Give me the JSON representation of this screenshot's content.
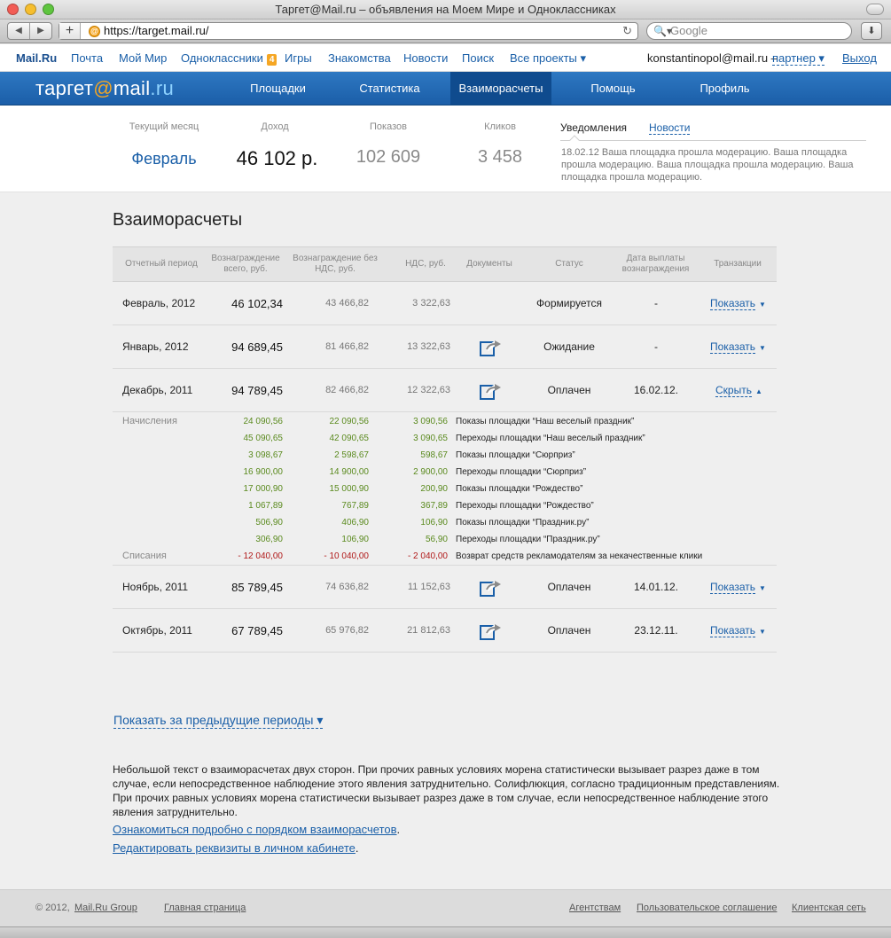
{
  "window": {
    "title": "Таргет@Mail.ru – объявления на Моем Мире и Одноклассниках"
  },
  "browser": {
    "url": "https://target.mail.ru/",
    "search_placeholder": "Google",
    "back_glyph": "◀",
    "forward_glyph": "▶",
    "new_tab_glyph": "+",
    "reload_glyph": "↻",
    "download_glyph": "⬇",
    "search_icon_glyph": "🔍▾"
  },
  "portal": {
    "brand": "Mail.Ru",
    "links": [
      {
        "label": "Почта"
      },
      {
        "label": "Мой Мир"
      },
      {
        "label": "Одноклассники",
        "badge": "4"
      },
      {
        "label": "Игры"
      },
      {
        "label": "Знакомства"
      },
      {
        "label": "Новости"
      },
      {
        "label": "Поиск"
      },
      {
        "label": "Все проекты ▾"
      }
    ],
    "user": "konstantinopol@mail.ru –",
    "partner": "партнер ▾",
    "logout": "Выход"
  },
  "nav": {
    "logo_left": "таргет",
    "logo_at": "@",
    "logo_mail": "mail",
    "logo_ru": ".ru",
    "items": [
      "Площадки",
      "Статистика",
      "Взаиморасчеты",
      "Помощь",
      "Профиль"
    ],
    "active_index": 2
  },
  "summary": {
    "labels": [
      "Текущий месяц",
      "Доход",
      "Показов",
      "Кликов"
    ],
    "month": "Февраль",
    "income": "46 102 р.",
    "shows": "102 609",
    "clicks": "3 458",
    "tab_active": "Уведомления",
    "tab_news": "Новости",
    "notice": "18.02.12 Ваша площадка прошла модерацию. Ваша площадка прошла модерацию. Ваша площадка прошла модерацию. Ваша площадка прошла модерацию."
  },
  "page": {
    "title": "Взаиморасчеты"
  },
  "table": {
    "headers": [
      "Отчетный период",
      "Вознаграждение всего, руб.",
      "Вознаграждение без НДС, руб.",
      "НДС, руб.",
      "Документы",
      "Статус",
      "Дата выплаты вознаграждения",
      "Транзакции"
    ],
    "rows": [
      {
        "period": "Февраль, 2012",
        "total": "46 102,34",
        "nonds": "43 466,82",
        "nds": "3 322,63",
        "doc": false,
        "status": "Формируется",
        "date": "-",
        "trans": "Показать",
        "caret": "▼"
      },
      {
        "period": "Январь, 2012",
        "total": "94 689,45",
        "nonds": "81 466,82",
        "nds": "13 322,63",
        "doc": true,
        "status": "Ожидание",
        "date": "-",
        "trans": "Показать",
        "caret": "▼"
      },
      {
        "period": "Декабрь, 2011",
        "total": "94 789,45",
        "nonds": "82 466,82",
        "nds": "12 322,63",
        "doc": true,
        "status": "Оплачен",
        "date": "16.02.12.",
        "trans": "Скрыть",
        "caret": "▲"
      }
    ],
    "details": [
      {
        "label": "Начисления",
        "total": "24 090,56",
        "nonds": "22 090,56",
        "nds": "3 090,56",
        "desc": "Показы площадки “Наш веселый праздник”"
      },
      {
        "label": "",
        "total": "45 090,65",
        "nonds": "42 090,65",
        "nds": "3 090,65",
        "desc": "Переходы площадки “Наш веселый праздник”"
      },
      {
        "label": "",
        "total": "3 098,67",
        "nonds": "2 598,67",
        "nds": "598,67",
        "desc": "Показы площадки “Сюрприз”"
      },
      {
        "label": "",
        "total": "16 900,00",
        "nonds": "14 900,00",
        "nds": "2 900,00",
        "desc": "Переходы  площадки “Сюрприз”"
      },
      {
        "label": "",
        "total": "17 000,90",
        "nonds": "15 000,90",
        "nds": "200,90",
        "desc": "Показы площадки “Рождество”"
      },
      {
        "label": "",
        "total": "1 067,89",
        "nonds": "767,89",
        "nds": "367,89",
        "desc": "Переходы площадки “Рождество”"
      },
      {
        "label": "",
        "total": "506,90",
        "nonds": "406,90",
        "nds": "106,90",
        "desc": "Показы площадки “Праздник.ру”"
      },
      {
        "label": "",
        "total": "306,90",
        "nonds": "106,90",
        "nds": "56,90",
        "desc": "Переходы площадки “Праздник.ру”"
      },
      {
        "label": "Списания",
        "total": "- 12 040,00",
        "nonds": "- 10 040,00",
        "nds": "- 2 040,00",
        "desc": "Возврат средств рекламодателям за некачественные клики",
        "negative": true
      }
    ],
    "rows_after": [
      {
        "period": "Ноябрь, 2011",
        "total": "85 789,45",
        "nonds": "74 636,82",
        "nds": "11 152,63",
        "doc": true,
        "status": "Оплачен",
        "date": "14.01.12.",
        "trans": "Показать",
        "caret": "▼"
      },
      {
        "period": "Октябрь, 2011",
        "total": "67 789,45",
        "nonds": "65 976,82",
        "nds": "21 812,63",
        "doc": true,
        "status": "Оплачен",
        "date": "23.12.11.",
        "trans": "Показать",
        "caret": "▼"
      }
    ]
  },
  "more_link": "Показать за предыдущие периоды ▾",
  "text": {
    "paragraph": "Небольшой текст о взаиморасчетах двух сторон. При прочих равных условиях морена статистически вызывает разрез даже в том случае, если непосредственное наблюдение этого явления затруднительно. Солифлюкция, согласно традиционным представлениям. При прочих равных условиях морена статистически вызывает разрез даже в том случае, если непосредственное наблюдение этого явления затруднительно.",
    "link1": "Ознакомиться подробно с порядком взаиморасчетов",
    "link2": "Редактировать реквизиты в личном кабинете",
    "dot": "."
  },
  "footer": {
    "copyright": "© 2012,",
    "group": "Mail.Ru Group",
    "home": "Главная страница",
    "agencies": "Агентствам",
    "agreement": "Пользовательское соглашение",
    "network": "Клиентская сеть"
  },
  "colors": {
    "accent": "#1a5fa8",
    "nav_bg": "#2373bd",
    "positive": "#5a8a1e",
    "negative": "#b01818"
  }
}
